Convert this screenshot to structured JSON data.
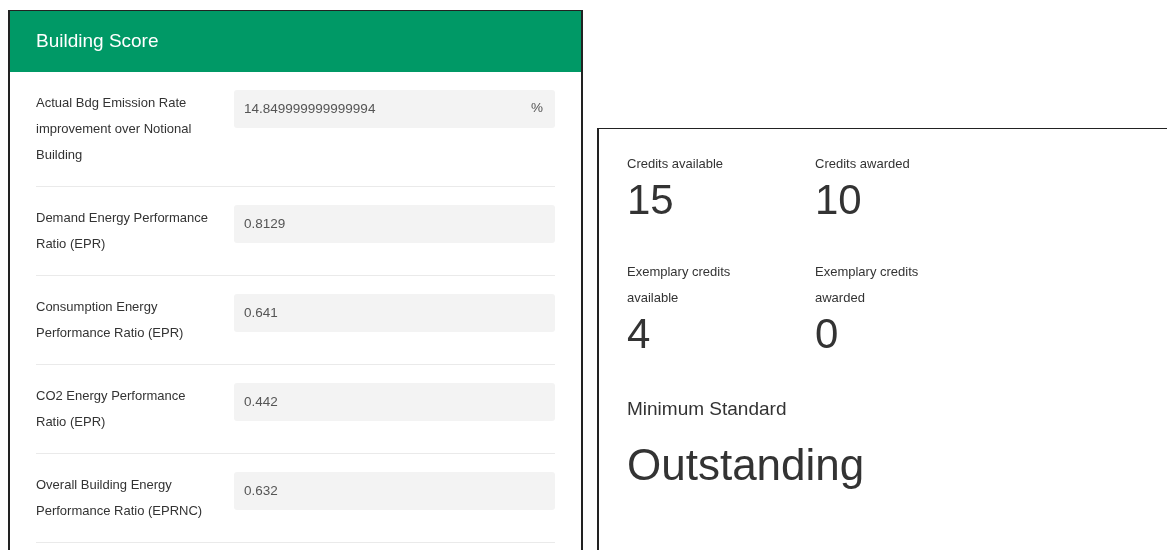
{
  "score_panel": {
    "title": "Building Score",
    "rows": [
      {
        "label": "Actual Bdg Emission Rate improvement over Notional Building",
        "value": "14.849999999999994",
        "unit": "%"
      },
      {
        "label": "Demand Energy Performance Ratio (EPR)",
        "value": "0.8129"
      },
      {
        "label": "Consumption Energy Performance Ratio (EPR)",
        "value": "0.641"
      },
      {
        "label": "CO2 Energy Performance Ratio (EPR)",
        "value": "0.442"
      },
      {
        "label": "Overall Building Energy Performance Ratio (EPRNC)",
        "value": "0.632"
      }
    ]
  },
  "credits_panel": {
    "stats": [
      {
        "label": "Credits available",
        "value": "15"
      },
      {
        "label": "Credits awarded",
        "value": "10"
      },
      {
        "label": "Exemplary credits available",
        "value": "4"
      },
      {
        "label": "Exemplary credits awarded",
        "value": "0"
      }
    ],
    "minimum_standard": {
      "label": "Minimum Standard",
      "value": "Outstanding"
    }
  }
}
